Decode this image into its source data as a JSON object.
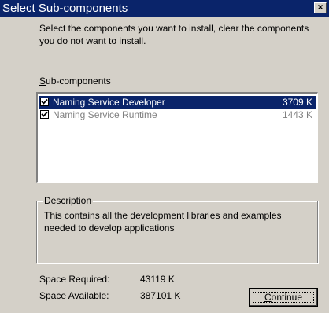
{
  "window": {
    "title": "Select Sub-components",
    "close_glyph": "×",
    "titlebar_color": "#0a246a",
    "face_color": "#d4d0c8"
  },
  "intro_text": "Select the components you want to install, clear the components you do not want to install.",
  "subcomponents": {
    "label_mnemonic": "S",
    "label_rest": "ub-components",
    "items": [
      {
        "name": "Naming Service Developer",
        "size": "3709 K",
        "checked": true,
        "selected": true
      },
      {
        "name": "Naming Service Runtime",
        "size": "1443 K",
        "checked": true,
        "selected": false
      }
    ]
  },
  "description": {
    "legend": "Description",
    "text": "This contains all the development libraries and examples needed to develop applications"
  },
  "space": {
    "required_label": "Space Required:",
    "required_value": "43119 K",
    "available_label": "Space Available:",
    "available_value": "387101 K"
  },
  "continue_button": {
    "mnemonic": "C",
    "rest": "ontinue"
  },
  "icons": {
    "checkbox": "checkmark-icon",
    "close": "close-icon"
  }
}
